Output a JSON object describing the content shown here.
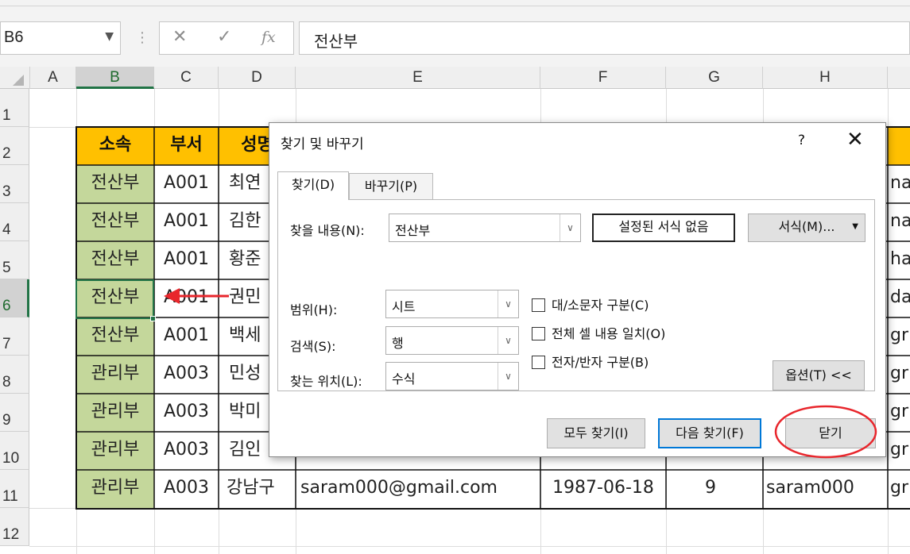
{
  "formula_bar": {
    "name_box": "B6",
    "cancel_icon": "close-icon",
    "enter_icon": "check-icon",
    "fx_label": "fx",
    "content": "전산부"
  },
  "columns": [
    "A",
    "B",
    "C",
    "D",
    "E",
    "F",
    "G",
    "H"
  ],
  "rows": [
    "1",
    "2",
    "3",
    "4",
    "5",
    "6",
    "7",
    "8",
    "9",
    "10",
    "11",
    "12"
  ],
  "selected_cell": "B6",
  "table": {
    "headers": [
      "소속",
      "부서",
      "성명"
    ],
    "rows": [
      {
        "dept": "전산부",
        "code": "A001",
        "name": "최연",
        "h": "na"
      },
      {
        "dept": "전산부",
        "code": "A001",
        "name": "김한",
        "h": "na"
      },
      {
        "dept": "전산부",
        "code": "A001",
        "name": "황준",
        "h": "ha"
      },
      {
        "dept": "전산부",
        "code": "A001",
        "name": "권민",
        "h": "da"
      },
      {
        "dept": "전산부",
        "code": "A001",
        "name": "백세",
        "h": "gr"
      },
      {
        "dept": "관리부",
        "code": "A003",
        "name": "민성",
        "h": "gr"
      },
      {
        "dept": "관리부",
        "code": "A003",
        "name": "박미",
        "h": "gr"
      },
      {
        "dept": "관리부",
        "code": "A003",
        "name": "김인",
        "h": "gr"
      },
      {
        "dept": "관리부",
        "code": "A003",
        "name": "강남구",
        "email": "saram000@gmail.com",
        "date": "1987-06-18",
        "num": "9",
        "id": "saram000",
        "h": "gr"
      }
    ]
  },
  "dialog": {
    "title": "찾기 및 바꾸기",
    "help": "?",
    "close": "✕",
    "tabs": [
      "찾기(D)",
      "바꾸기(P)"
    ],
    "find_label": "찾을 내용(N):",
    "find_value": "전산부",
    "format_preview": "설정된 서식 없음",
    "format_button": "서식(M)...",
    "within_label": "범위(H):",
    "within_value": "시트",
    "search_label": "검색(S):",
    "search_value": "행",
    "lookin_label": "찾는 위치(L):",
    "lookin_value": "수식",
    "match_case": "대/소문자 구분(C)",
    "match_entire": "전체 셀 내용 일치(O)",
    "match_byte": "전자/반자 구분(B)",
    "options_button": "옵션(T) <<",
    "find_all_button": "모두 찾기(I)",
    "find_next_button": "다음 찾기(F)",
    "close_button": "닫기"
  },
  "annotation_colors": {
    "arrow": "#e8262c",
    "circle": "#e8262c"
  }
}
